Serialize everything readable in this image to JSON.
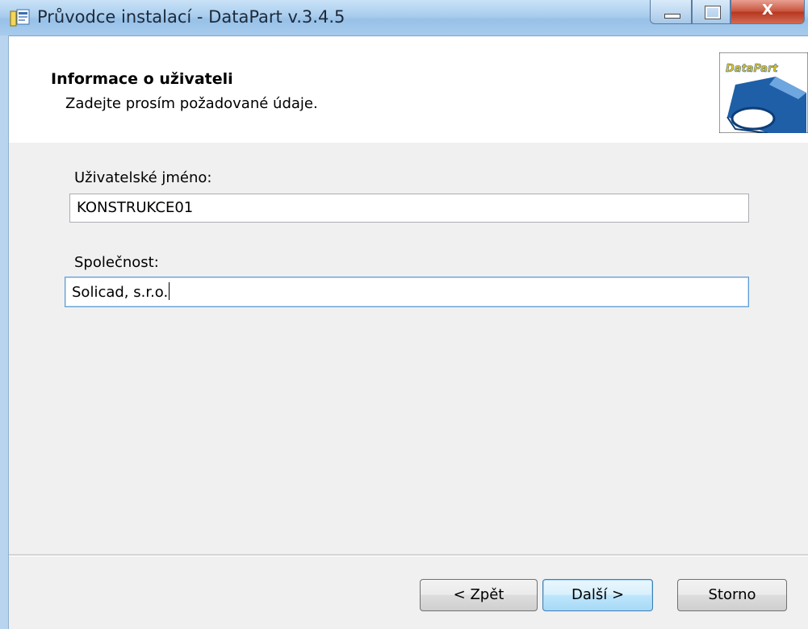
{
  "window": {
    "title": "Průvodce instalací - DataPart v.3.4.5",
    "close_glyph": "X"
  },
  "header": {
    "title": "Informace o uživateli",
    "subtitle": "Zadejte prosím požadované údaje.",
    "logo_text": "DataPart"
  },
  "form": {
    "username_label": "Uživatelské jméno:",
    "username_value": "KONSTRUKCE01",
    "company_label": "Společnost:",
    "company_value": "Solicad, s.r.o."
  },
  "buttons": {
    "back": "< Zpět",
    "next": "Další >",
    "cancel": "Storno"
  },
  "icons": {
    "app": "installer-icon",
    "minimize": "minimize-icon",
    "maximize": "maximize-icon",
    "close": "close-icon"
  },
  "colors": {
    "titlebar": "#a9cdee",
    "close_button": "#c7523b",
    "logo_blue": "#1f5fa8",
    "logo_yellow": "#e8c21c"
  }
}
